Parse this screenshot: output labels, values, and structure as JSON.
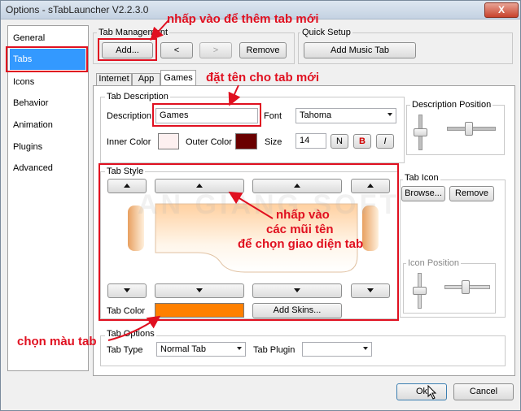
{
  "window": {
    "title": "Options - sTabLauncher V2.2.3.0",
    "close_glyph": "X"
  },
  "sidebar": {
    "items": [
      "General",
      "Tabs",
      "Icons",
      "Behavior",
      "Animation",
      "Plugins",
      "Advanced"
    ],
    "selected": "Tabs"
  },
  "tab_management": {
    "label": "Tab Management",
    "add": "Add...",
    "prev": "<",
    "next": ">",
    "remove": "Remove"
  },
  "quick_setup": {
    "label": "Quick Setup",
    "add_music": "Add Music Tab"
  },
  "inner_tabs": [
    "Internet",
    "App",
    "Games"
  ],
  "tab_description": {
    "label": "Tab Description",
    "description_label": "Description",
    "description_value": "Games",
    "font_label": "Font",
    "font_value": "Tahoma",
    "inner_color_label": "Inner Color",
    "outer_color_label": "Outer Color",
    "size_label": "Size",
    "size_value": "14",
    "bold_n": "N",
    "bold_b": "B",
    "italic": "I",
    "inner_color": "#fdf0f0",
    "outer_color": "#6a0000"
  },
  "description_position": {
    "label": "Description Position"
  },
  "tab_style": {
    "label": "Tab Style",
    "tab_color_label": "Tab Color",
    "tab_color": "#ff8000",
    "add_skins": "Add Skins..."
  },
  "tab_icon": {
    "label": "Tab Icon",
    "browse": "Browse...",
    "remove": "Remove"
  },
  "icon_position": {
    "label": "Icon Position"
  },
  "tab_options": {
    "label": "Tab Options",
    "type_label": "Tab Type",
    "type_value": "Normal Tab",
    "plugin_label": "Tab Plugin",
    "plugin_value": ""
  },
  "footer": {
    "ok": "Ok",
    "cancel": "Cancel"
  },
  "watermark": "AN GIANG SOFT",
  "annotations": {
    "add_tab": "nhấp vào để thêm tab mới",
    "name_tab": "đặt tên cho tab mới",
    "arrows_line1": "nhấp vào",
    "arrows_line2": "các mũi tên",
    "arrows_line3": "để chọn giao diện tab",
    "tab_color": "chọn màu tab"
  },
  "accent_colors": {
    "annotation_red": "#e01020",
    "selection_blue": "#3399ff"
  }
}
